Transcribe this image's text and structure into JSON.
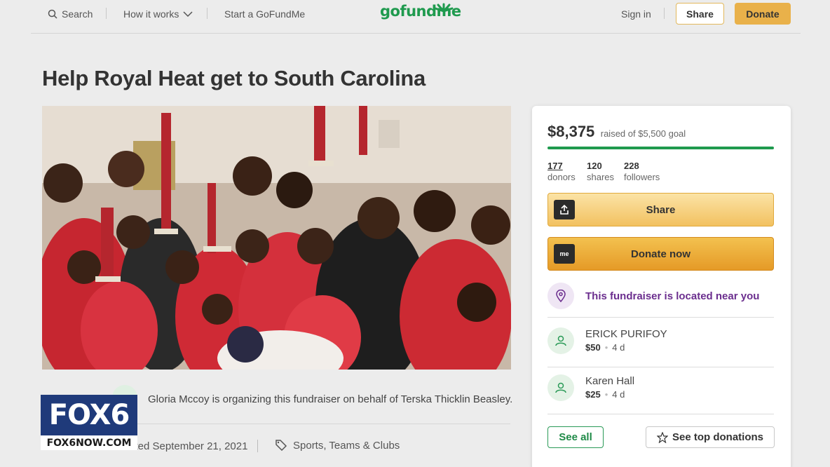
{
  "nav": {
    "search_label": "Search",
    "how_it_works_label": "How it works",
    "start_label": "Start a GoFundMe",
    "logo_text": "gofundme",
    "signin_label": "Sign in",
    "share_label": "Share",
    "donate_label": "Donate"
  },
  "campaign": {
    "title": "Help Royal Heat get to South Carolina",
    "photo_icon": "team-photo-with-trophies",
    "organizer_text": "Gloria Mccoy is organizing this fundraiser on behalf of Terska Thicklin Beasley.",
    "created_text": "Created September 21, 2021",
    "category": "Sports, Teams & Clubs"
  },
  "donation_card": {
    "raised": "$8,375",
    "goal_text": "raised of $5,500 goal",
    "progress_fraction": 1.0,
    "stats": [
      {
        "value": "177",
        "label": "donors"
      },
      {
        "value": "120",
        "label": "shares"
      },
      {
        "value": "228",
        "label": "followers"
      }
    ],
    "share_button": "Share",
    "donate_button": "Donate now",
    "donate_icon_text": "me",
    "location_text": "This fundraiser is located near you",
    "donations": [
      {
        "name": "ERICK PURIFOY",
        "amount": "$50",
        "time": "4 d"
      },
      {
        "name": "Karen Hall",
        "amount": "$25",
        "time": "4 d"
      }
    ],
    "see_all": "See all",
    "see_top": "See top donations"
  },
  "overlay": {
    "brand": "FOX6",
    "site": "FOX6NOW.COM"
  },
  "colors": {
    "brand_green": "#1f9a4e",
    "donate_orange": "#e9b14a",
    "location_purple": "#6b2e8e",
    "fox_blue": "#1f3a7a"
  }
}
